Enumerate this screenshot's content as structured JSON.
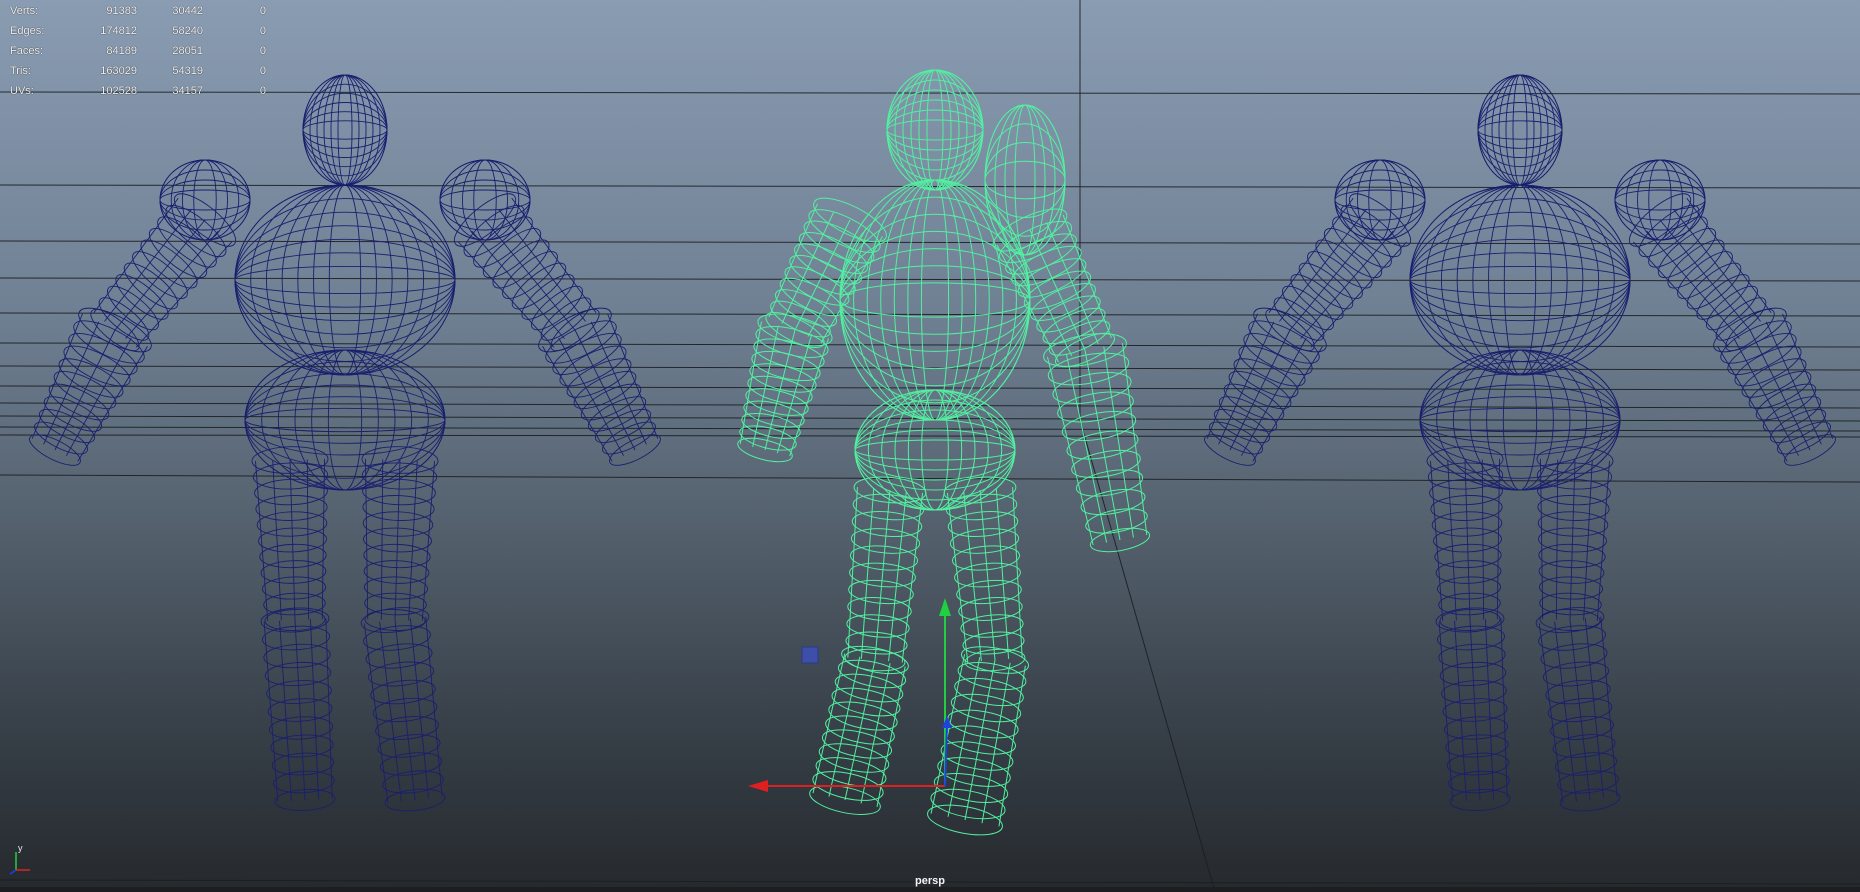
{
  "hud": {
    "rows": [
      {
        "label": "Verts:",
        "total": "91383",
        "selected": "30442",
        "component": "0"
      },
      {
        "label": "Edges:",
        "total": "174812",
        "selected": "58240",
        "component": "0"
      },
      {
        "label": "Faces:",
        "total": "84189",
        "selected": "28051",
        "component": "0"
      },
      {
        "label": "Tris:",
        "total": "163029",
        "selected": "54319",
        "component": "0"
      },
      {
        "label": "UVs:",
        "total": "102528",
        "selected": "34157",
        "component": "0"
      }
    ]
  },
  "viewport": {
    "camera_label": "persp",
    "axis_up_label": "y",
    "colors": {
      "unselected_wire": "#1a1f6e",
      "selected_wire": "#52f0a0",
      "grid_line": "#1b1e22",
      "manip_x": "#e02020",
      "manip_y": "#20d040",
      "manip_z": "#2040e0"
    },
    "objects": [
      {
        "name": "character-left",
        "selected": false
      },
      {
        "name": "character-center",
        "selected": true
      },
      {
        "name": "character-right",
        "selected": false
      }
    ]
  }
}
